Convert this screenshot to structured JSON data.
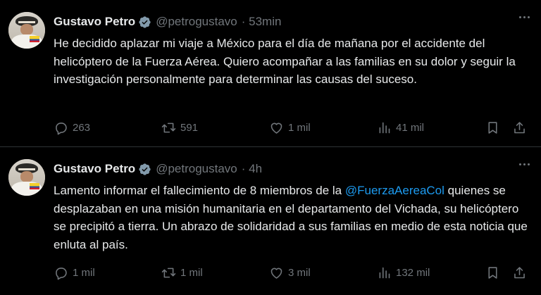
{
  "tweets": [
    {
      "author_name": "Gustavo Petro",
      "handle": "@petrogustavo",
      "time": "· 53min",
      "text_before": "He decidido aplazar mi viaje a México para el día de mañana por el accidente del helicóptero de la Fuerza Aérea. Quiero acompañar a las familias en su dolor y seguir la investigación personalmente para determinar las causas del suceso.",
      "mention": "",
      "text_after": "",
      "replies": "263",
      "retweets": "591",
      "likes": "1 mil",
      "views": "41 mil"
    },
    {
      "author_name": "Gustavo Petro",
      "handle": "@petrogustavo",
      "time": "· 4h",
      "text_before": "Lamento informar el fallecimiento de 8 miembros de la ",
      "mention": "@FuerzaAereaCol",
      "text_after": " quienes se desplazaban en una misión humanitaria en el departamento del Vichada, su helicóptero se precipitó a tierra. Un abrazo de solidaridad a sus familias en medio de esta noticia que enluta al país.",
      "replies": "1 mil",
      "retweets": "1 mil",
      "likes": "3 mil",
      "views": "132 mil"
    }
  ],
  "icons": {
    "verified": "verified-badge-icon",
    "more": "more-options-icon",
    "reply": "reply-icon",
    "retweet": "retweet-icon",
    "like": "like-heart-icon",
    "views": "views-bar-chart-icon",
    "bookmark": "bookmark-icon",
    "share": "share-icon"
  },
  "colors": {
    "background": "#000000",
    "text": "#e7e9ea",
    "secondary": "#71767b",
    "accent": "#1d9bf0",
    "divider": "#2f3336"
  }
}
